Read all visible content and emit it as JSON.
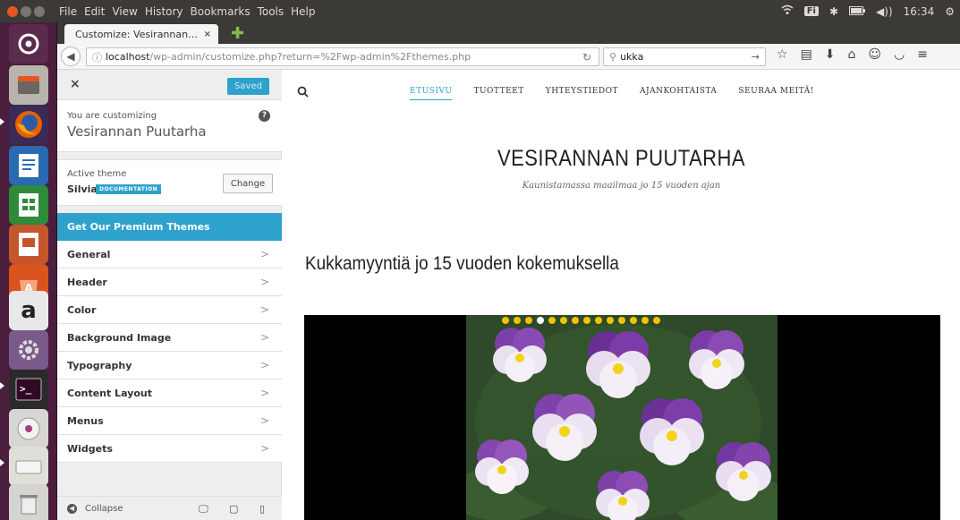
{
  "os": {
    "menus": [
      "File",
      "Edit",
      "View",
      "History",
      "Bookmarks",
      "Tools",
      "Help"
    ],
    "tray": {
      "keyboard": "Fi",
      "time": "16:34"
    }
  },
  "browser": {
    "tab_title": "Customize: Vesirannan…",
    "tab_close": "×",
    "url_prefix": "ⓘ",
    "url_host": "localhost",
    "url_path": "/wp-admin/customize.php?return=%2Fwp-admin%2Fthemes.php",
    "search_value": "ukka"
  },
  "customizer": {
    "close": "×",
    "saved_label": "Saved",
    "customizing_label": "You are customizing",
    "site_name": "Vesirannan Puutarha",
    "help": "?",
    "active_theme_label": "Active theme",
    "theme_name": "Silvia",
    "doc_badge": "DOCUMENTATION",
    "change_label": "Change",
    "premium_label": "Get Our Premium Themes",
    "sections": [
      "General",
      "Header",
      "Color",
      "Background Image",
      "Typography",
      "Content Layout",
      "Menus",
      "Widgets"
    ],
    "collapse_label": "Collapse"
  },
  "preview": {
    "nav": [
      "ETUSIVU",
      "TUOTTEET",
      "YHTEYSTIEDOT",
      "AJANKOHTAISTA",
      "SEURAA MEITÄ!"
    ],
    "site_title": "VESIRANNAN PUUTARHA",
    "tagline": "Kaunistamassa maailmaa jo 15 vuoden ajan",
    "heading": "Kukkamyyntiä jo 15 vuoden kokemuksella",
    "slider_dots": 14,
    "active_dot": 3
  },
  "colors": {
    "accent": "#2ea2cc",
    "launcher": "#4b1e3d",
    "topbar": "#3b3a36"
  }
}
